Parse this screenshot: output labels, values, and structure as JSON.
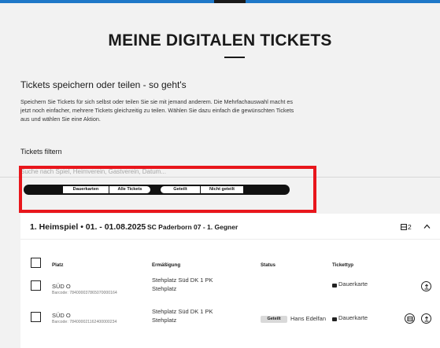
{
  "header": {
    "title": "MEINE DIGITALEN TICKETS"
  },
  "howto": {
    "heading": "Tickets speichern oder teilen - so geht's",
    "text": "Speichern Sie Tickets für sich selbst oder teilen Sie sie mit jemand anderem. Die Mehrfachauswahl macht es jetzt noch einfacher, mehrere Tickets gleichzeitig zu teilen. Wählen Sie dazu einfach die gewünschten Tickets aus und wählen Sie eine Aktion."
  },
  "filter": {
    "heading": "Tickets filtern",
    "search_placeholder": "Suche nach Spiel, Heimverein, Gastverein, Datum...",
    "type_options": [
      "Dauerkarten",
      "Alle Tickets"
    ],
    "share_options": [
      "Geteilt",
      "Nicht geteilt"
    ]
  },
  "colors": {
    "accent_bar": "#1f78c8",
    "highlight": "#e8161c"
  },
  "game": {
    "title": "1. Heimspiel • 01. - 01.08.2025",
    "opponent": "SC Paderborn 07  -  1. Gegner",
    "ticket_count": "2",
    "icons": {
      "count": "ticket-stack-icon",
      "collapse": "chevron-up-icon"
    }
  },
  "table": {
    "columns": [
      "Platz",
      "Ermäßigung",
      "Status",
      "Tickettyp"
    ],
    "rows": [
      {
        "seat": "SÜD O",
        "barcode": "Barcode: 784000037865070000164",
        "discount_line1": "Stehplatz Süd DK 1 PK",
        "discount_line2": "Stehplatz",
        "status_badge": "",
        "status_name": "",
        "ticket_type": "Dauerkarte",
        "actions": [
          "share-icon"
        ]
      },
      {
        "seat": "SÜD O",
        "barcode": "Barcode: 784000021162400000234",
        "discount_line1": "Stehplatz Süd DK 1 PK",
        "discount_line2": "Stehplatz",
        "status_badge": "Geteilt",
        "status_name": "Hans Edelfan",
        "ticket_type": "Dauerkarte",
        "actions": [
          "unshare-icon",
          "share-icon"
        ]
      }
    ]
  }
}
